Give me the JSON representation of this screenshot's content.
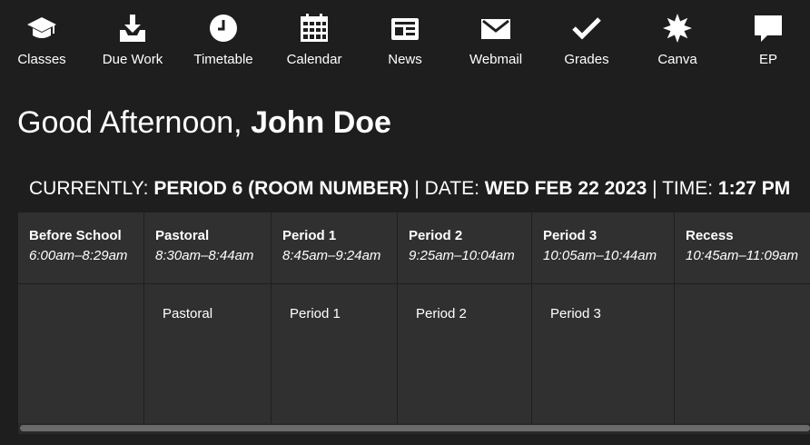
{
  "nav": {
    "items": [
      {
        "label": "Classes",
        "icon": "graduation-cap-icon"
      },
      {
        "label": "Due Work",
        "icon": "download-tray-icon"
      },
      {
        "label": "Timetable",
        "icon": "clock-icon"
      },
      {
        "label": "Calendar",
        "icon": "calendar-icon"
      },
      {
        "label": "News",
        "icon": "newspaper-icon"
      },
      {
        "label": "Webmail",
        "icon": "envelope-icon"
      },
      {
        "label": "Grades",
        "icon": "checkmark-icon"
      },
      {
        "label": "Canva",
        "icon": "badge-icon"
      },
      {
        "label": "EP",
        "icon": "speech-bubble-icon"
      }
    ]
  },
  "greeting": {
    "prefix": "Good Afternoon, ",
    "name": "John Doe"
  },
  "status": {
    "currently_label": "CURRENTLY: ",
    "currently_value": "PERIOD 6 (ROOM NUMBER)",
    "date_label": " | DATE: ",
    "date_value": "WED FEB 22 2023",
    "time_label": " | TIME: ",
    "time_value": "1:27 PM"
  },
  "timetable": {
    "columns": [
      {
        "name": "Before School",
        "time": "6:00am–8:29am",
        "class": ""
      },
      {
        "name": "Pastoral",
        "time": "8:30am–8:44am",
        "class": "Pastoral"
      },
      {
        "name": "Period 1",
        "time": "8:45am–9:24am",
        "class": "Period 1"
      },
      {
        "name": "Period 2",
        "time": "9:25am–10:04am",
        "class": "Period 2"
      },
      {
        "name": "Period 3",
        "time": "10:05am–10:44am",
        "class": "Period 3"
      },
      {
        "name": "Recess",
        "time": "10:45am–11:09am",
        "class": ""
      }
    ]
  },
  "colors": {
    "background": "#1e1e1e",
    "panel": "#303030",
    "text": "#ffffff"
  }
}
